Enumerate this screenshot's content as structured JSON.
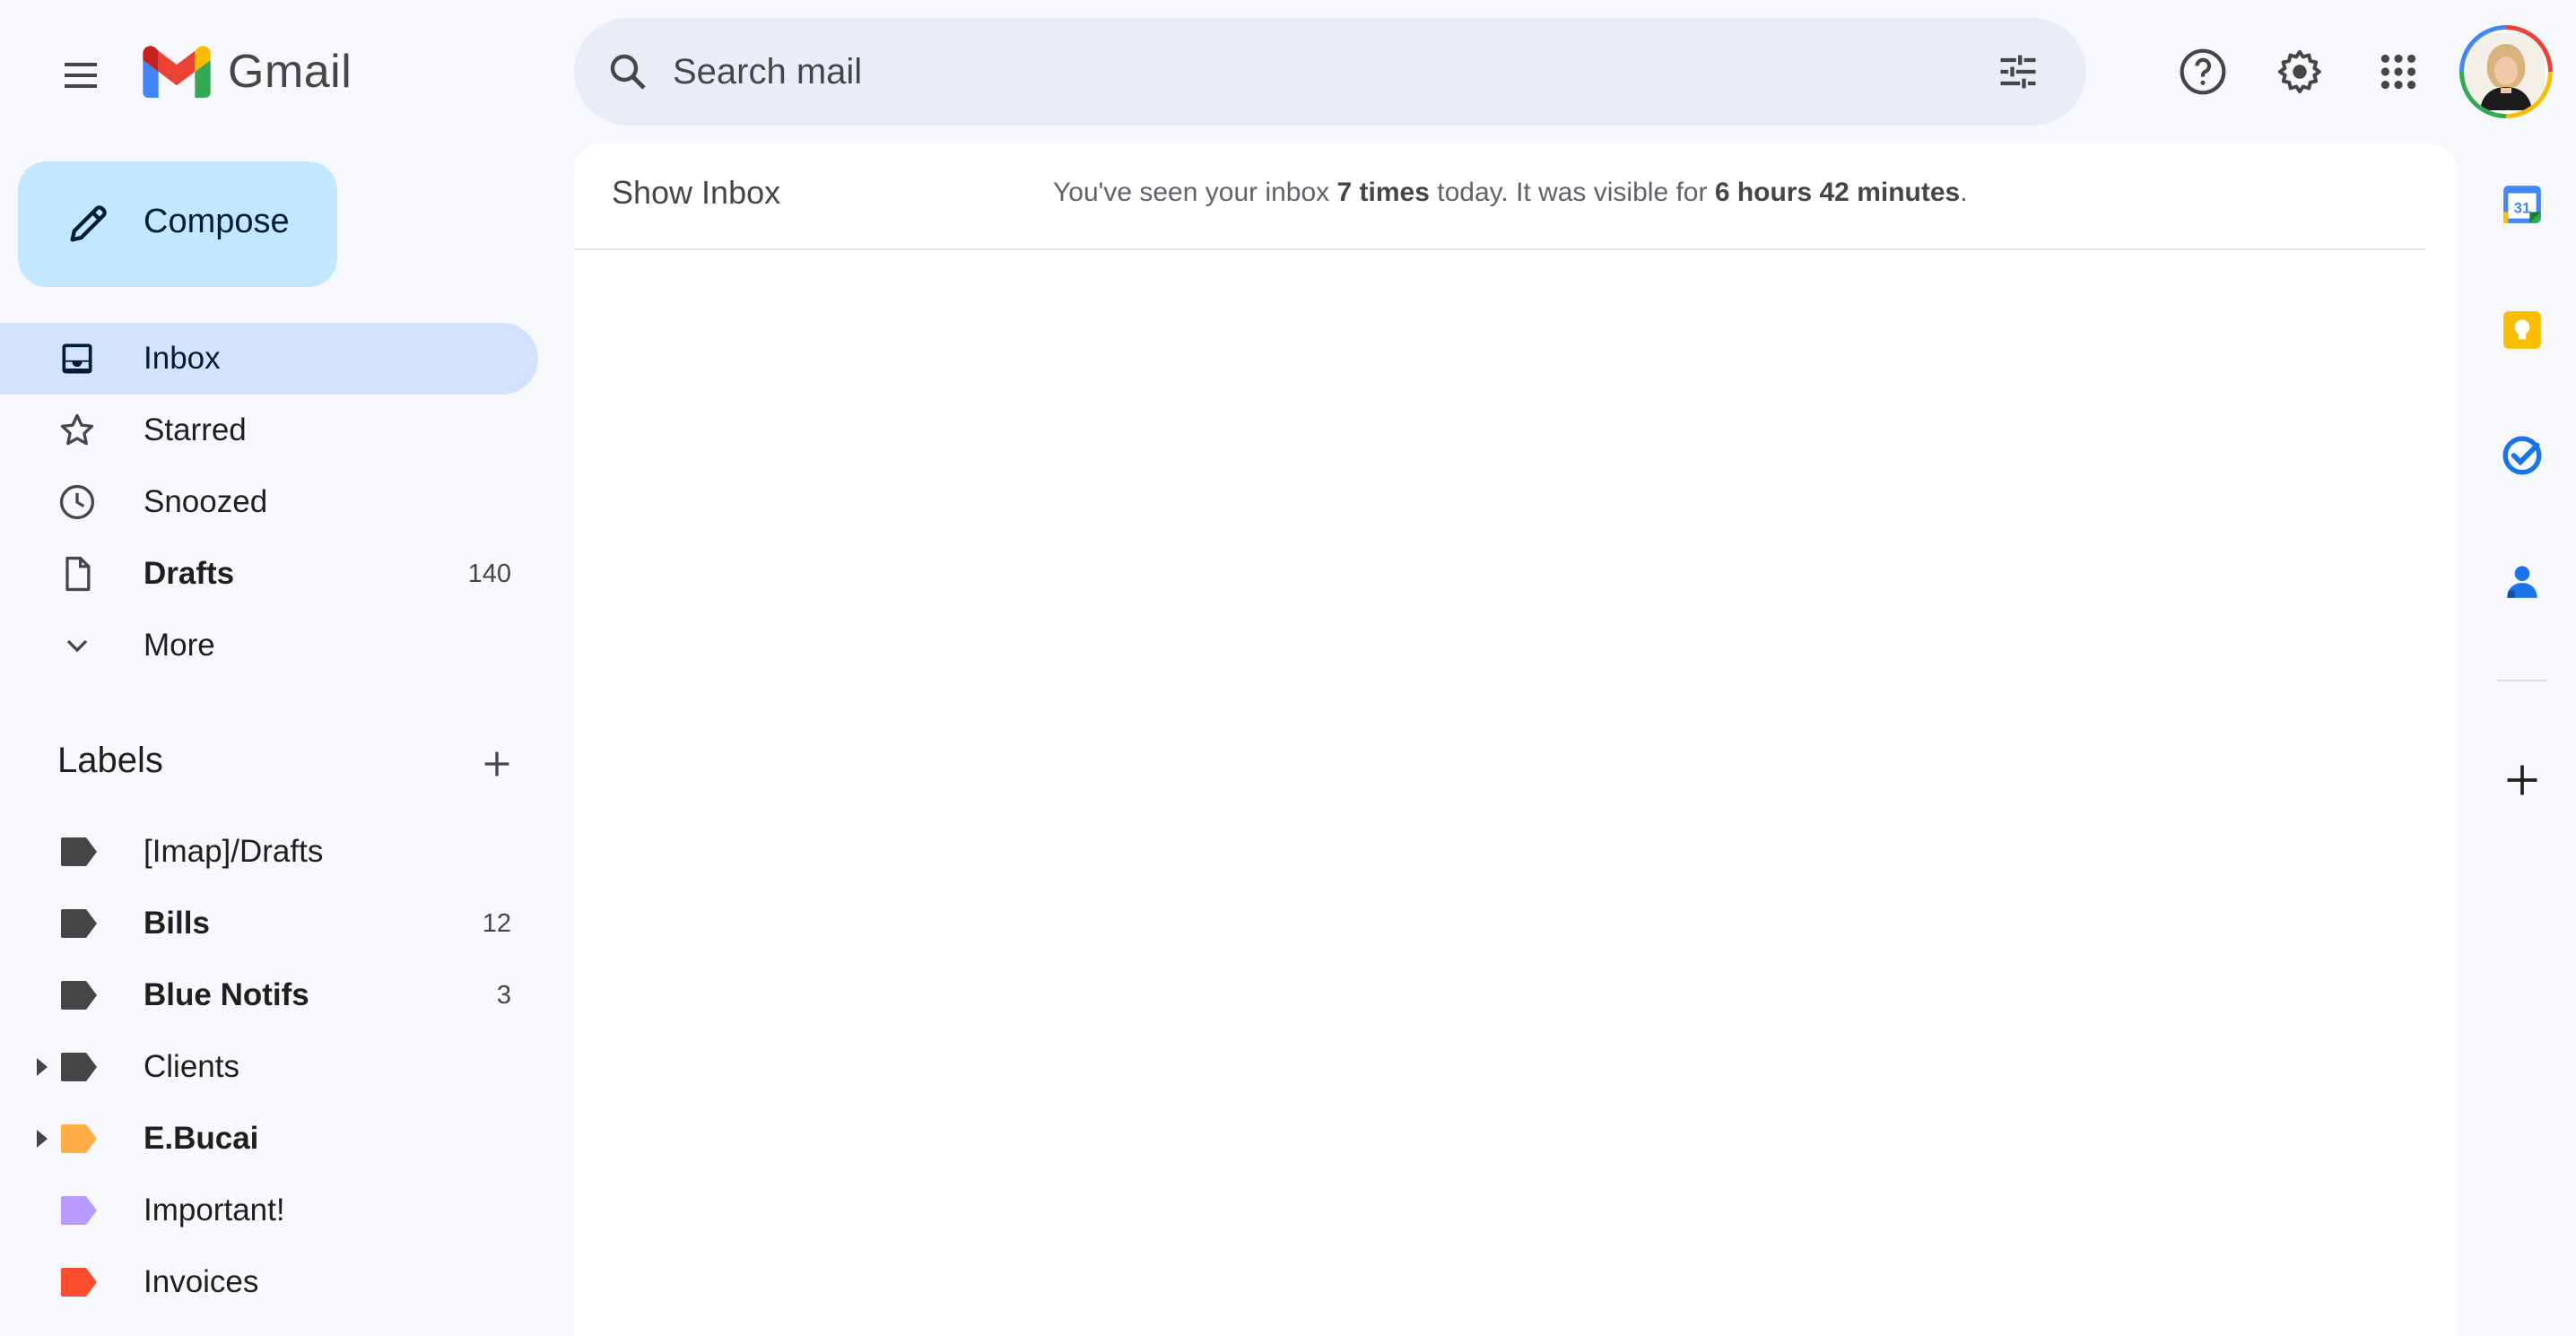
{
  "app": {
    "name": "Gmail"
  },
  "search": {
    "placeholder": "Search mail"
  },
  "compose": {
    "label": "Compose"
  },
  "nav": [
    {
      "label": "Inbox",
      "count": "",
      "bold": false,
      "active": true,
      "icon": "inbox-icon"
    },
    {
      "label": "Starred",
      "count": "",
      "bold": false,
      "active": false,
      "icon": "star-icon"
    },
    {
      "label": "Snoozed",
      "count": "",
      "bold": false,
      "active": false,
      "icon": "clock-icon"
    },
    {
      "label": "Drafts",
      "count": "140",
      "bold": true,
      "active": false,
      "icon": "draft-icon"
    },
    {
      "label": "More",
      "count": "",
      "bold": false,
      "active": false,
      "icon": "chevron-down-icon"
    }
  ],
  "labels": {
    "heading": "Labels",
    "items": [
      {
        "name": "[Imap]/Drafts",
        "count": "",
        "bold": false,
        "color": "#444746",
        "expandable": false
      },
      {
        "name": "Bills",
        "count": "12",
        "bold": true,
        "color": "#444746",
        "expandable": false
      },
      {
        "name": "Blue Notifs",
        "count": "3",
        "bold": true,
        "color": "#444746",
        "expandable": false
      },
      {
        "name": "Clients",
        "count": "",
        "bold": false,
        "color": "#444746",
        "expandable": true
      },
      {
        "name": "E.Bucai",
        "count": "",
        "bold": true,
        "color": "#ffad47",
        "expandable": true
      },
      {
        "name": "Important!",
        "count": "",
        "bold": false,
        "color": "#b99aff",
        "expandable": false
      },
      {
        "name": "Invoices",
        "count": "",
        "bold": false,
        "color": "#fb4c2f",
        "expandable": false
      }
    ]
  },
  "main": {
    "show_inbox": "Show Inbox",
    "notice": {
      "part1": "You've seen your inbox ",
      "times": "7 times",
      "part2": " today. It was visible for ",
      "duration": "6 hours 42 minutes",
      "part3": "."
    }
  },
  "side_apps": [
    {
      "name": "calendar-icon",
      "text": "31"
    },
    {
      "name": "keep-icon"
    },
    {
      "name": "tasks-icon"
    },
    {
      "name": "contacts-icon"
    }
  ],
  "colors": {
    "background": "#f6f8fc",
    "compose": "#c2e7ff",
    "active_nav": "#d3e3fd",
    "search": "#e9eef6"
  }
}
